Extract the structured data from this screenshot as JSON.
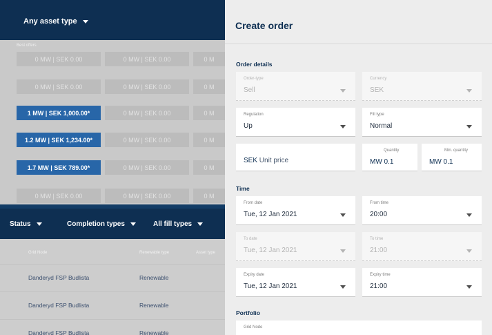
{
  "background": {
    "asset_filter": "Any asset type",
    "best_offers_label": "Best offers",
    "offers": {
      "row1": [
        "0 MW  |  SEK 0.00",
        "0 MW  |  SEK 0.00",
        "0 M"
      ],
      "row2": [
        "0 MW  |  SEK 0.00",
        "0 MW  |  SEK 0.00",
        "0 M"
      ],
      "row3": [
        "1 MW  |  SEK 1,000.00*",
        "0 MW  |  SEK 0.00",
        "0 M"
      ],
      "row4": [
        "1.2 MW  |  SEK 1,234.00*",
        "0 MW  |  SEK 0.00",
        "0 M"
      ],
      "row5": [
        "1.7 MW  |  SEK 789.00*",
        "0 MW  |  SEK 0.00",
        "0 M"
      ],
      "row6": [
        "0 MW  |  SEK 0.00",
        "0 MW  |  SEK 0.00",
        "0 M"
      ]
    },
    "filters": {
      "status": "Status",
      "completion": "Completion types",
      "fill": "All fill types"
    },
    "table": {
      "headers": {
        "grid_node": "Grid Node",
        "renewable_type": "Renewable type",
        "asset_type": "Asset type"
      },
      "rows": [
        {
          "grid_node": "Danderyd FSP Budlista",
          "renewable_type": "Renewable"
        },
        {
          "grid_node": "Danderyd FSP Budlista",
          "renewable_type": "Renewable"
        },
        {
          "grid_node": "Danderyd FSP Budlista",
          "renewable_type": "Renewable"
        }
      ]
    }
  },
  "panel": {
    "title": "Create order",
    "order_details": {
      "section_title": "Order details",
      "order_type": {
        "label": "Order-type",
        "value": "Sell"
      },
      "currency": {
        "label": "Currency",
        "value": "SEK"
      },
      "regulation": {
        "label": "Regulation",
        "value": "Up"
      },
      "fill_type": {
        "label": "Fill type",
        "value": "Normal"
      },
      "unit_price": {
        "currency": "SEK",
        "placeholder": "Unit price"
      },
      "quantity": {
        "label": "Quantity",
        "value": "MW 0.1"
      },
      "min_quantity": {
        "label": "Min. quantity",
        "value": "MW 0.1"
      }
    },
    "time": {
      "section_title": "Time",
      "from_date": {
        "label": "From date",
        "value": "Tue, 12 Jan 2021"
      },
      "from_time": {
        "label": "From time",
        "value": "20:00"
      },
      "to_date": {
        "label": "To date",
        "value": "Tue, 12 Jan 2021"
      },
      "to_time": {
        "label": "To time",
        "value": "21:00"
      },
      "expiry_date": {
        "label": "Expiry date",
        "value": "Tue, 12 Jan 2021"
      },
      "expiry_time": {
        "label": "Expiry time",
        "value": "21:00"
      }
    },
    "portfolio": {
      "section_title": "Portfolio",
      "grid_node": {
        "label": "Grid Node"
      }
    }
  },
  "colors": {
    "navy": "#0e2f52",
    "offer_active": "#2866a8",
    "panel_bg": "#ededed"
  }
}
